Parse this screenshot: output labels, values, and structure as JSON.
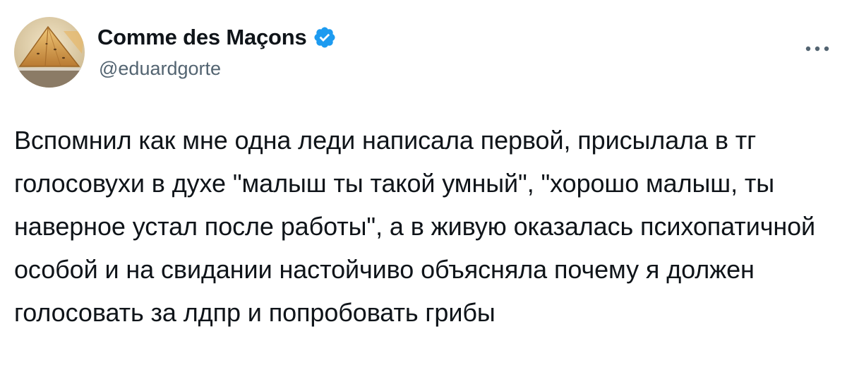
{
  "author": {
    "display_name": "Comme des Maçons",
    "handle": "@eduardgorte",
    "verified": true,
    "avatar_icon": "avatar-samsa-pastry",
    "verified_icon": "verified-badge-icon"
  },
  "more_icon": "more-options-icon",
  "tweet": {
    "text": "Вспомнил как мне одна леди написала первой, присылала в тг голосовухи в духе \"малыш ты такой умный\", \"хорошо малыш, ты наверное устал после работы\", а в живую оказалась психопатичной особой и на свидании настойчиво объясняла почему я должен голосовать за лдпр и попробовать грибы"
  },
  "colors": {
    "text": "#0f1419",
    "secondary": "#536471",
    "verified": "#1d9bf0",
    "background": "#ffffff"
  }
}
